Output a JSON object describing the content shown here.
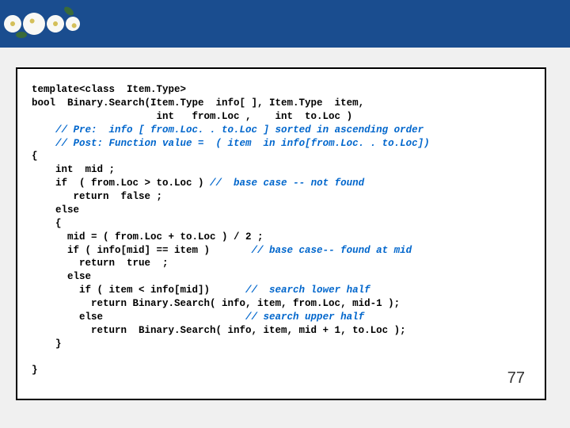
{
  "code": {
    "l1": "template<class  Item.Type>",
    "l2": "bool  Binary.Search(Item.Type  info[ ], Item.Type  item,",
    "l3": "                     int   from.Loc ,    int  to.Loc )",
    "l4a": "    ",
    "l4b": "// Pre:  info [ from.Loc. . to.Loc ] sorted in ascending order",
    "l5a": "    ",
    "l5b": "// Post: Function value =  ( item  in info[from.Loc. . to.Loc])",
    "l6": "{",
    "l7": "    int  mid ;",
    "l8a": "    if  ( from.Loc > to.Loc ) ",
    "l8b": "//  base case -- not found",
    "l9": "       return  false ;",
    "l10": "    else",
    "l11": "    {",
    "l12": "      mid = ( from.Loc + to.Loc ) / 2 ;",
    "l13a": "      if ( info[mid] == item )       ",
    "l13b": "// base case-- found at mid",
    "l14": "        return  true  ;",
    "l15": "      else",
    "l16a": "        if ( item < info[mid])      ",
    "l16b": "//  search lower half",
    "l17": "          return Binary.Search( info, item, from.Loc, mid-1 );",
    "l18a": "        else                        ",
    "l18b": "// search upper half",
    "l19": "          return  Binary.Search( info, item, mid + 1, to.Loc );",
    "l20": "    }",
    "l21": "",
    "l22": "}"
  },
  "page_number": "77"
}
